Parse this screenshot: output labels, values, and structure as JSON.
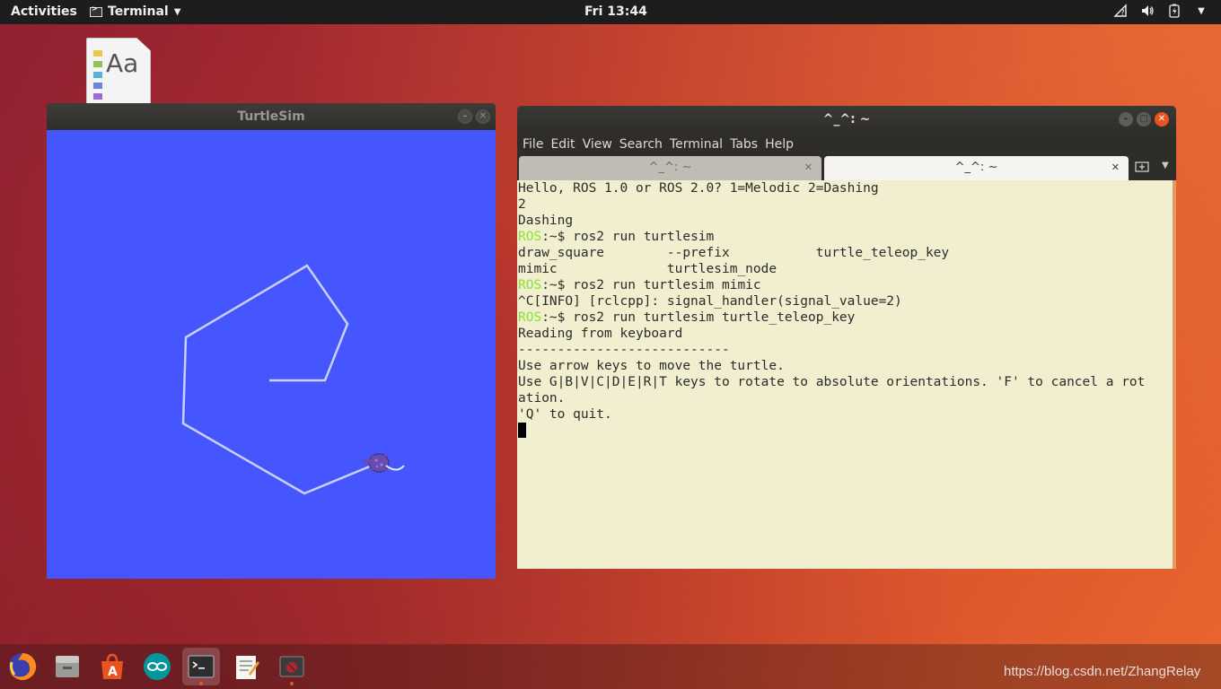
{
  "topbar": {
    "activities": "Activities",
    "app_name": "Terminal",
    "clock": "Fri 13:44",
    "tray_icons": [
      "network-question-icon",
      "volume-icon",
      "battery-icon",
      "system-menu-caret-icon"
    ]
  },
  "desktop": {
    "icon": "font-file-icon",
    "icon_text": "Aa"
  },
  "turtlesim": {
    "title": "TurtleSim",
    "background_color": "#4556ff",
    "path_color": "#c8d0ff"
  },
  "terminal": {
    "title": "^_^: ~",
    "menu": [
      "File",
      "Edit",
      "View",
      "Search",
      "Terminal",
      "Tabs",
      "Help"
    ],
    "tabs": [
      {
        "label": "^_^: ~",
        "active": false
      },
      {
        "label": "^_^: ~",
        "active": true
      }
    ],
    "lines": [
      {
        "prompt": "",
        "text": "Hello, ROS 1.0 or ROS 2.0? 1=Melodic 2=Dashing"
      },
      {
        "prompt": "",
        "text": "2"
      },
      {
        "prompt": "",
        "text": "Dashing"
      },
      {
        "prompt": "ROS",
        "text": ":~$ ros2 run turtlesim"
      },
      {
        "prompt": "",
        "text": "draw_square        --prefix           turtle_teleop_key"
      },
      {
        "prompt": "",
        "text": "mimic              turtlesim_node"
      },
      {
        "prompt": "ROS",
        "text": ":~$ ros2 run turtlesim mimic"
      },
      {
        "prompt": "",
        "text": "^C[INFO] [rclcpp]: signal_handler(signal_value=2)"
      },
      {
        "prompt": "ROS",
        "text": ":~$ ros2 run turtlesim turtle_teleop_key"
      },
      {
        "prompt": "",
        "text": "Reading from keyboard"
      },
      {
        "prompt": "",
        "text": "---------------------------"
      },
      {
        "prompt": "",
        "text": "Use arrow keys to move the turtle."
      },
      {
        "prompt": "",
        "text": "Use G|B|V|C|D|E|R|T keys to rotate to absolute orientations. 'F' to cancel a rot"
      },
      {
        "prompt": "",
        "text": "ation."
      },
      {
        "prompt": "",
        "text": "'Q' to quit."
      }
    ]
  },
  "dock": {
    "items": [
      {
        "name": "firefox-icon",
        "active": false
      },
      {
        "name": "files-icon",
        "active": false
      },
      {
        "name": "software-center-icon",
        "active": false
      },
      {
        "name": "arduino-icon",
        "active": false
      },
      {
        "name": "terminal-icon",
        "active": true
      },
      {
        "name": "text-editor-icon",
        "active": false
      },
      {
        "name": "turtlesim-app-icon",
        "active": false
      }
    ],
    "watermark": "https://blog.csdn.net/ZhangRelay"
  }
}
